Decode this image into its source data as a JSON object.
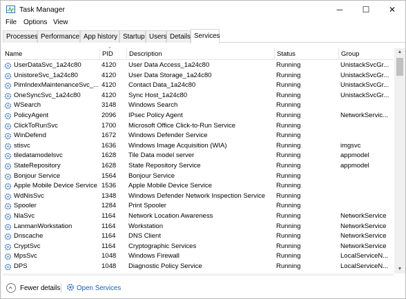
{
  "window": {
    "title": "Task Manager",
    "controls": {
      "minimize": "─",
      "maximize": "☐",
      "close": "✕"
    }
  },
  "menu": [
    "File",
    "Options",
    "View"
  ],
  "tabs": [
    "Processes",
    "Performance",
    "App history",
    "Startup",
    "Users",
    "Details",
    "Services"
  ],
  "active_tab": "Services",
  "columns": [
    "Name",
    "PID",
    "Description",
    "Status",
    "Group"
  ],
  "services": [
    {
      "name": "UserDataSvc_1a24c80",
      "pid": "4120",
      "description": "User Data Access_1a24c80",
      "status": "Running",
      "group": "UnistackSvcGr..."
    },
    {
      "name": "UnistoreSvc_1a24c80",
      "pid": "4120",
      "description": "User Data Storage_1a24c80",
      "status": "Running",
      "group": "UnistackSvcGr..."
    },
    {
      "name": "PimIndexMaintenanceSvc_...",
      "pid": "4120",
      "description": "Contact Data_1a24c80",
      "status": "Running",
      "group": "UnistackSvcGr..."
    },
    {
      "name": "OneSyncSvc_1a24c80",
      "pid": "4120",
      "description": "Sync Host_1a24c80",
      "status": "Running",
      "group": "UnistackSvcGr..."
    },
    {
      "name": "WSearch",
      "pid": "3148",
      "description": "Windows Search",
      "status": "Running",
      "group": ""
    },
    {
      "name": "PolicyAgent",
      "pid": "2096",
      "description": "IPsec Policy Agent",
      "status": "Running",
      "group": "NetworkServic..."
    },
    {
      "name": "ClickToRunSvc",
      "pid": "1700",
      "description": "Microsoft Office Click-to-Run Service",
      "status": "Running",
      "group": ""
    },
    {
      "name": "WinDefend",
      "pid": "1672",
      "description": "Windows Defender Service",
      "status": "Running",
      "group": ""
    },
    {
      "name": "stisvc",
      "pid": "1636",
      "description": "Windows Image Acquisition (WIA)",
      "status": "Running",
      "group": "imgsvc"
    },
    {
      "name": "tiledatamodelsvc",
      "pid": "1628",
      "description": "Tile Data model server",
      "status": "Running",
      "group": "appmodel"
    },
    {
      "name": "StateRepository",
      "pid": "1628",
      "description": "State Repository Service",
      "status": "Running",
      "group": "appmodel"
    },
    {
      "name": "Bonjour Service",
      "pid": "1564",
      "description": "Bonjour Service",
      "status": "Running",
      "group": ""
    },
    {
      "name": "Apple Mobile Device Service",
      "pid": "1536",
      "description": "Apple Mobile Device Service",
      "status": "Running",
      "group": ""
    },
    {
      "name": "WdNisSvc",
      "pid": "1348",
      "description": "Windows Defender Network Inspection Service",
      "status": "Running",
      "group": ""
    },
    {
      "name": "Spooler",
      "pid": "1284",
      "description": "Print Spooler",
      "status": "Running",
      "group": ""
    },
    {
      "name": "NlaSvc",
      "pid": "1164",
      "description": "Network Location Awareness",
      "status": "Running",
      "group": "NetworkService"
    },
    {
      "name": "LanmanWorkstation",
      "pid": "1164",
      "description": "Workstation",
      "status": "Running",
      "group": "NetworkService"
    },
    {
      "name": "Dnscache",
      "pid": "1164",
      "description": "DNS Client",
      "status": "Running",
      "group": "NetworkService"
    },
    {
      "name": "CryptSvc",
      "pid": "1164",
      "description": "Cryptographic Services",
      "status": "Running",
      "group": "NetworkService"
    },
    {
      "name": "MpsSvc",
      "pid": "1048",
      "description": "Windows Firewall",
      "status": "Running",
      "group": "LocalServiceN..."
    },
    {
      "name": "DPS",
      "pid": "1048",
      "description": "Diagnostic Policy Service",
      "status": "Running",
      "group": "LocalServiceN..."
    }
  ],
  "footer": {
    "fewer_details": "Fewer details",
    "open_services": "Open Services"
  },
  "colors": {
    "link": "#1a5fb4",
    "gear": "#4a7fc1"
  }
}
